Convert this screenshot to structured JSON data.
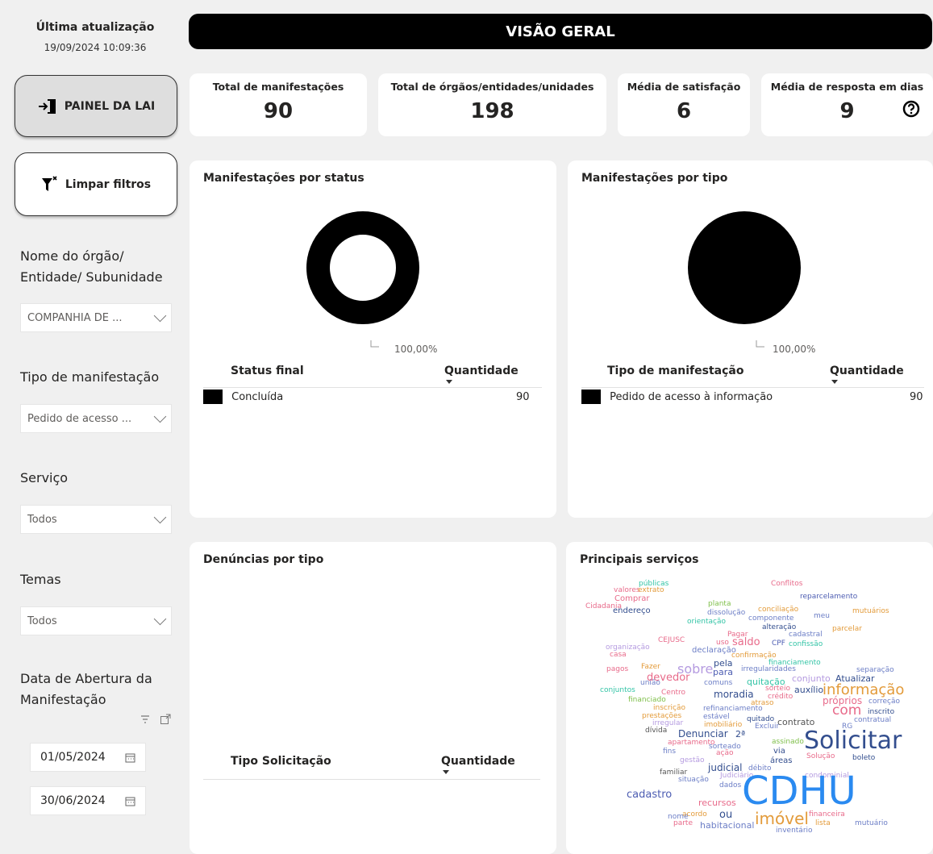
{
  "sidebar": {
    "update_label": "Última atualização",
    "update_date": "19/09/2024 10:09:36",
    "lai_button": "PAINEL DA LAI",
    "clear_button": "Limpar filtros",
    "filters": [
      {
        "label": "Nome do órgão/ Entidade/ Subunidade",
        "value": "COMPANHIA DE ..."
      },
      {
        "label": "Tipo de manifestação",
        "value": "Pedido de acesso ..."
      },
      {
        "label": "Serviço",
        "value": "Todos"
      },
      {
        "label": "Temas",
        "value": "Todos"
      }
    ],
    "date_label": "Data de Abertura da Manifestação",
    "date_start": "01/05/2024",
    "date_end": "30/06/2024"
  },
  "header": {
    "title": "VISÃO GERAL"
  },
  "kpis": [
    {
      "label": "Total de manifestações",
      "value": "90"
    },
    {
      "label": "Total de órgãos/entidades/unidades",
      "value": "198"
    },
    {
      "label": "Média de satisfação",
      "value": "6"
    },
    {
      "label": "Média de resposta em dias",
      "value": "9"
    }
  ],
  "status_card": {
    "title": "Manifestações por status",
    "donut_label": "100,00%",
    "col1": "Status final",
    "col2": "Quantidade",
    "rows": [
      {
        "name": "Concluída",
        "qty": "90"
      }
    ]
  },
  "tipo_card": {
    "title": "Manifestações por tipo",
    "pie_label": "100,00%",
    "col1": "Tipo de manifestação",
    "col2": "Quantidade",
    "rows": [
      {
        "name": "Pedido de acesso à informação",
        "qty": "90"
      }
    ]
  },
  "denuncias_card": {
    "title": "Denúncias por tipo",
    "col1": "Tipo Solicitação",
    "col2": "Quantidade"
  },
  "servicos_card": {
    "title": "Principais serviços",
    "words": [
      "públicas",
      "valores",
      "extrato",
      "Comprar",
      "Cidadania",
      "endereço",
      "Conflitos",
      "reparcelamento",
      "planta",
      "conciliação",
      "mutuários",
      "dissolução",
      "componente",
      "meu",
      "orientação",
      "alteração",
      "cadastral",
      "parcelar",
      "CEJUSC",
      "Pagar",
      "uso",
      "saldo",
      "CPF",
      "confissão",
      "organização",
      "casa",
      "declaração",
      "confirmação",
      "financiamento",
      "pagos",
      "Fazer",
      "devedor",
      "sobre",
      "pela",
      "para",
      "irregularidades",
      "separação",
      "união",
      "comuns",
      "quitação",
      "conjunto",
      "Atualizar",
      "conjuntos",
      "Centro",
      "moradia",
      "sorteio",
      "auxílio",
      "informação",
      "financiado",
      "crédito",
      "atraso",
      "próprios",
      "correção",
      "inscrição",
      "refinanciamento",
      "com",
      "inscrito",
      "prestações",
      "estável",
      "quitado",
      "contrato",
      "contratual",
      "irregular",
      "imobiliário",
      "Excluir",
      "RG",
      "dívida",
      "Denunciar",
      "2ª",
      "apartamento",
      "sorteado",
      "assinado",
      "Solicitar",
      "fins",
      "ação",
      "via",
      "gestão",
      "judicial",
      "áreas",
      "Solução",
      "boleto",
      "familiar",
      "débito",
      "situação",
      "Judiciário",
      "condominial",
      "dados",
      "cadastro",
      "CDHU",
      "recursos",
      "acordo",
      "nome",
      "ou",
      "imóvel",
      "financeira",
      "parte",
      "habitacional",
      "lista",
      "mutuário",
      "inventário"
    ]
  },
  "colors": {
    "header_bg": "#000000",
    "card_bg": "#ffffff",
    "page_bg": "#f0f0f0"
  }
}
